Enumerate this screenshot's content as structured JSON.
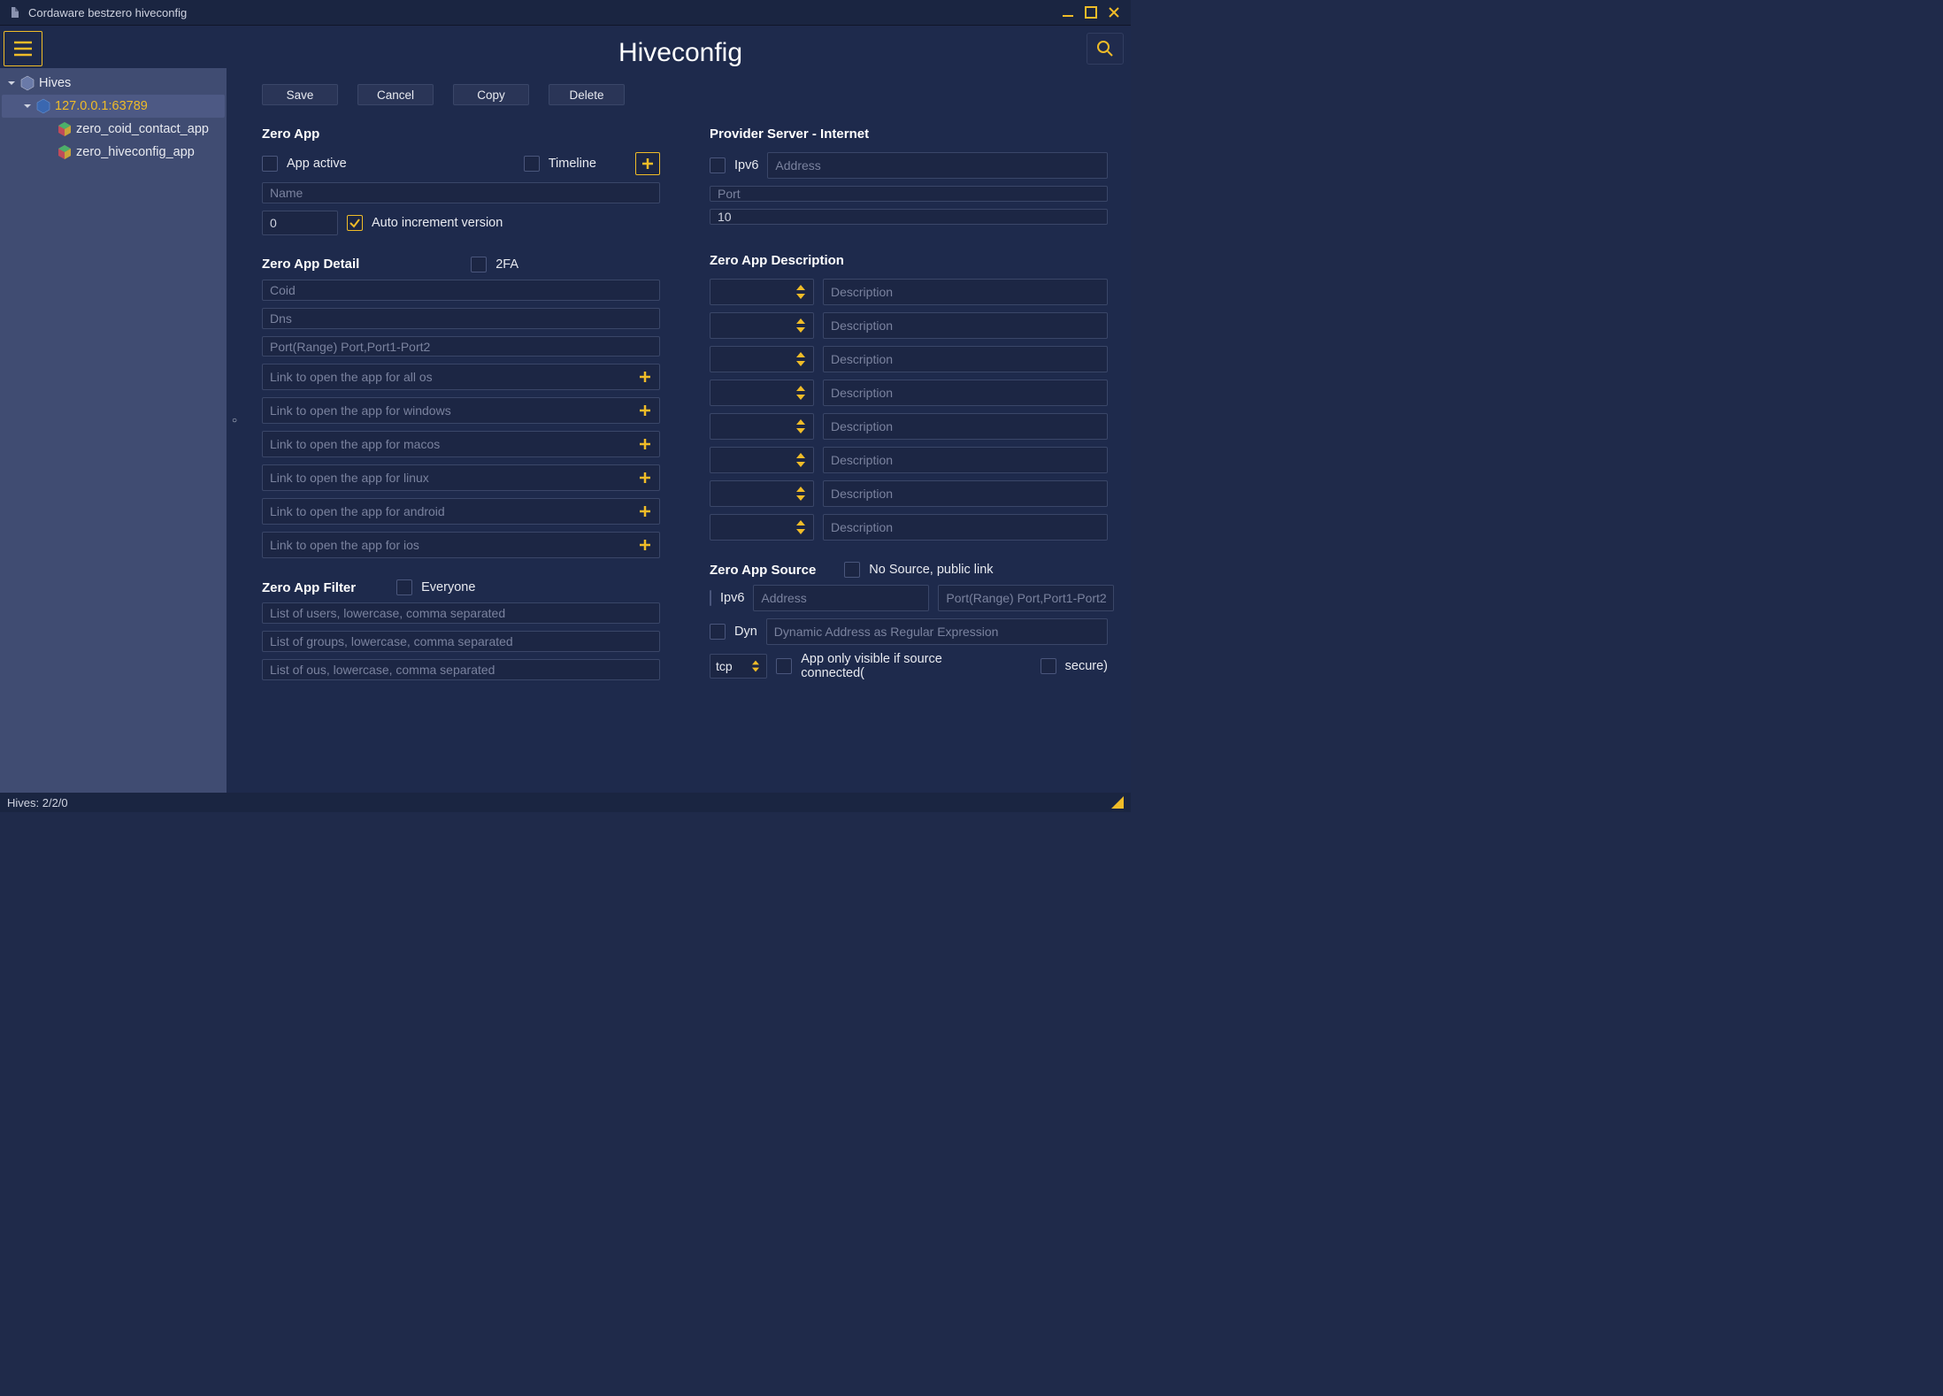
{
  "window": {
    "title": "Cordaware bestzero hiveconfig"
  },
  "page_title": "Hiveconfig",
  "toolbar": {
    "save": "Save",
    "cancel": "Cancel",
    "copy": "Copy",
    "delete": "Delete"
  },
  "tree": {
    "root": "Hives",
    "host": "127.0.0.1:63789",
    "leaf1": "zero_coid_contact_app",
    "leaf2": "zero_hiveconfig_app"
  },
  "left": {
    "section_app": "Zero App",
    "app_active": "App active",
    "timeline": "Timeline",
    "name_ph": "Name",
    "version_value": "0",
    "auto_inc": "Auto increment version",
    "section_detail": "Zero App Detail",
    "twofa": "2FA",
    "coid_ph": "Coid",
    "dns_ph": "Dns",
    "port_ph": "Port(Range) Port,Port1-Port2",
    "link_all_ph": "Link to open the app for all os",
    "link_win_ph": "Link to open the app for windows",
    "link_mac_ph": "Link to open the app for macos",
    "link_lin_ph": "Link to open the app for linux",
    "link_and_ph": "Link to open the app for android",
    "link_ios_ph": "Link to open the app for ios",
    "section_filter": "Zero App Filter",
    "everyone": "Everyone",
    "users_ph": "List of users, lowercase, comma separated",
    "groups_ph": "List of groups, lowercase, comma separated",
    "ous_ph": "List of ous, lowercase, comma separated"
  },
  "right": {
    "section_provider": "Provider Server - Internet",
    "ipv6": "Ipv6",
    "addr_ph": "Address",
    "port_ph": "Port",
    "ten_value": "10",
    "section_desc": "Zero App Description",
    "desc_ph": "Description",
    "section_source": "Zero App Source",
    "no_source": "No Source, public link",
    "src_ipv6": "Ipv6",
    "src_addr_ph": "Address",
    "src_port_ph": "Port(Range) Port,Port1-Port2",
    "dyn": "Dyn",
    "dyn_ph": "Dynamic Address as Regular Expression",
    "proto": "tcp",
    "only_visible": "App only visible if source connected(",
    "secure": "secure)"
  },
  "status": {
    "hives": "Hives: 2/2/0"
  }
}
